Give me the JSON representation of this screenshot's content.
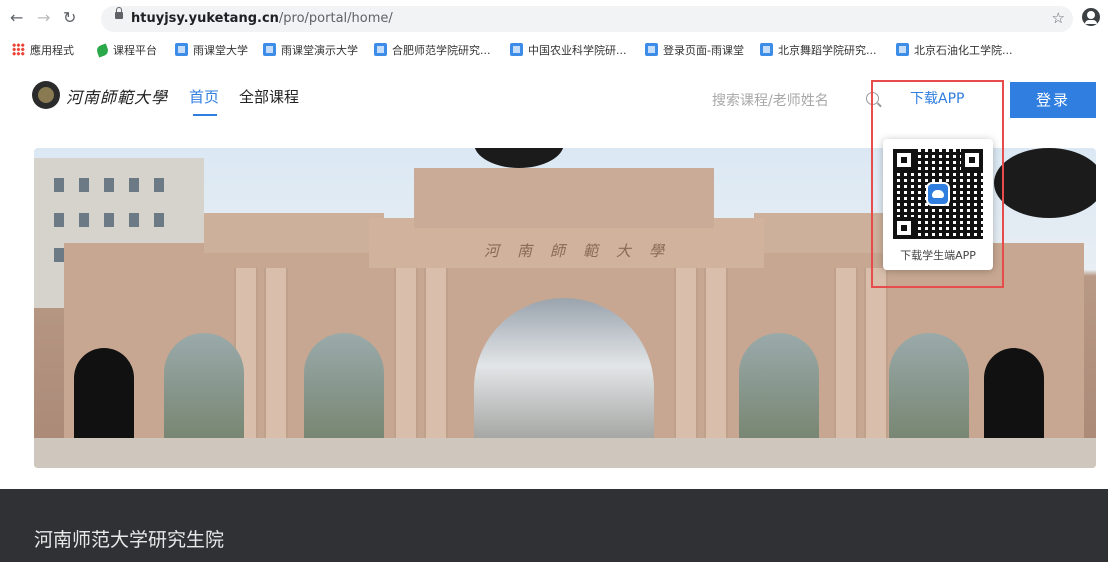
{
  "browser": {
    "url_host": "htuyjsy.yuketang.cn",
    "url_path": "/pro/portal/home/",
    "bookmarks": [
      {
        "label": "應用程式",
        "icon": "apps-grid-icon"
      },
      {
        "label": "课程平台",
        "icon": "leaf-icon"
      },
      {
        "label": "雨课堂大学",
        "icon": "rain-classroom-icon"
      },
      {
        "label": "雨课堂演示大学",
        "icon": "rain-classroom-icon"
      },
      {
        "label": "合肥师范学院研究...",
        "icon": "rain-classroom-icon"
      },
      {
        "label": "中国农业科学院研...",
        "icon": "rain-classroom-icon"
      },
      {
        "label": "登录页面-雨课堂",
        "icon": "rain-classroom-icon"
      },
      {
        "label": "北京舞蹈学院研究...",
        "icon": "rain-classroom-icon"
      },
      {
        "label": "北京石油化工学院...",
        "icon": "rain-classroom-icon"
      }
    ]
  },
  "header": {
    "logo_text": "河南師範大學",
    "nav": {
      "home": "首页",
      "all_courses": "全部课程"
    },
    "search_placeholder": "搜索课程/老师姓名",
    "download_app": "下载APP",
    "login": "登录"
  },
  "qr_popup": {
    "caption": "下载学生端APP"
  },
  "hero": {
    "inscription": "河南師範大學"
  },
  "footer": {
    "title": "河南师范大学研究生院"
  },
  "colors": {
    "accent": "#2f7ee0",
    "footer_bg": "#2f3134",
    "highlight": "#e74c4c"
  }
}
